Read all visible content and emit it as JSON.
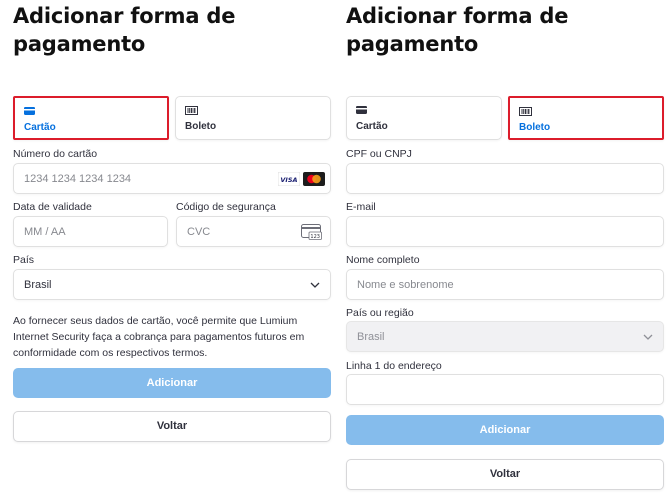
{
  "left": {
    "title": "Adicionar forma de pagamento",
    "tabs": [
      {
        "label": "Cartão",
        "icon": "card-icon"
      },
      {
        "label": "Boleto",
        "icon": "barcode-icon"
      }
    ],
    "card_number": {
      "label": "Número do cartão",
      "placeholder": "1234 1234 1234 1234",
      "brands": [
        "VISA",
        "Mastercard"
      ]
    },
    "expiry": {
      "label": "Data de validade",
      "placeholder": "MM / AA"
    },
    "cvc": {
      "label": "Código de segurança",
      "placeholder": "CVC",
      "icon_text": "123"
    },
    "country": {
      "label": "País",
      "value": "Brasil"
    },
    "notice": "Ao fornecer seus dados de cartão, você permite que Lumium Internet Security faça a cobrança para pagamentos futuros em conformidade com os respectivos termos.",
    "add_button": "Adicionar",
    "back_button": "Voltar"
  },
  "right": {
    "title": "Adicionar forma de pagamento",
    "tabs": [
      {
        "label": "Cartão",
        "icon": "card-icon"
      },
      {
        "label": "Boleto",
        "icon": "barcode-icon"
      }
    ],
    "cpf": {
      "label": "CPF ou CNPJ",
      "value": ""
    },
    "email": {
      "label": "E-mail",
      "value": ""
    },
    "full_name": {
      "label": "Nome completo",
      "placeholder": "Nome e sobrenome"
    },
    "country": {
      "label": "País ou região",
      "value": "Brasil"
    },
    "address": {
      "label": "Linha 1 do endereço",
      "value": ""
    },
    "add_button": "Adicionar",
    "back_button": "Voltar"
  },
  "colors": {
    "accent": "#0570de",
    "highlight": "#dc1c2b",
    "button_disabled": "#85bcec"
  }
}
